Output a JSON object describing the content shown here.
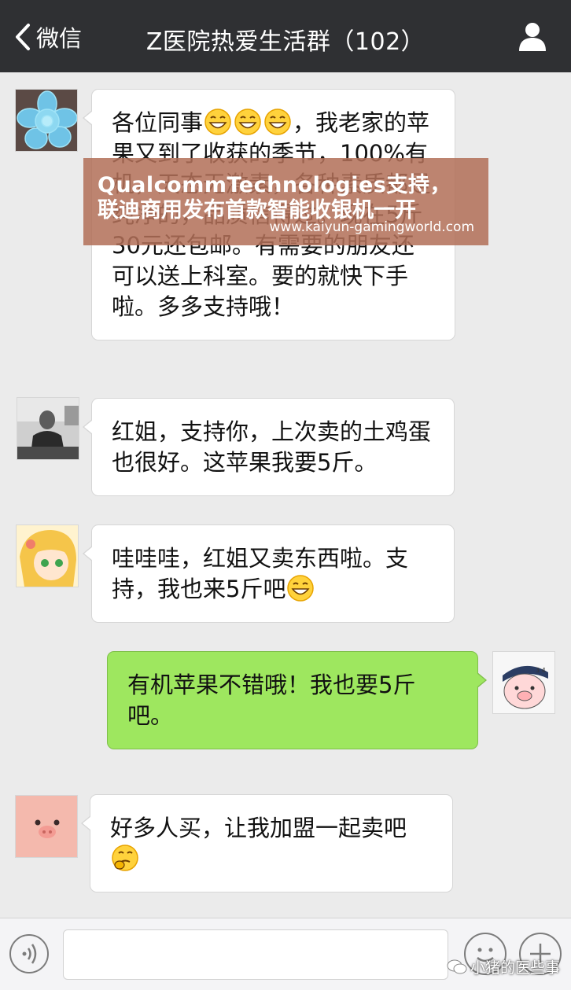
{
  "header": {
    "back_label": "微信",
    "title": "Z医院热爱生活群（102）"
  },
  "messages": [
    {
      "side": "left",
      "avatar": "succulent-avatar",
      "text_before_emoji": "各位同事",
      "emoji": [
        "grin-emoji",
        "grin-emoji",
        "grin-emoji"
      ],
      "text_after_emoji": "，我老家的苹果又到了收获的季节，100%有机，天态无激素，各种素质都是纯净的，品质信得过。现在5斤30元还包邮。有需要的朋友还可以送上科室。要的就快下手啦。多多支持哦！"
    },
    {
      "side": "left",
      "avatar": "man-photo-avatar",
      "text": "红姐，支持你，上次卖的土鸡蛋也很好。这苹果我要5斤。"
    },
    {
      "side": "left",
      "avatar": "anime-girl-avatar",
      "text": "哇哇哇，红姐又卖东西啦。支持，我也来5斤吧",
      "emoji": [
        "grin-emoji"
      ]
    },
    {
      "side": "right",
      "avatar": "pig-cartoon-avatar",
      "text": "有机苹果不错哦！我也要5斤吧。"
    },
    {
      "side": "left",
      "avatar": "pink-pig-avatar",
      "text": "好多人买，让我加盟一起卖吧",
      "emoji": [
        "thinking-emoji"
      ]
    }
  ],
  "overlay": {
    "line1": "QualcommTechnologies支持，",
    "line2": "联迪商用发布首款智能收银机一开",
    "url": "www.kaiyun-gamingworld.com"
  },
  "input": {
    "placeholder": ""
  },
  "source_mark": "小猪的医些事",
  "colors": {
    "topbar": "#2f3033",
    "background": "#ebebeb",
    "own_bubble": "#9ee75f",
    "overlay": "#b27058"
  }
}
